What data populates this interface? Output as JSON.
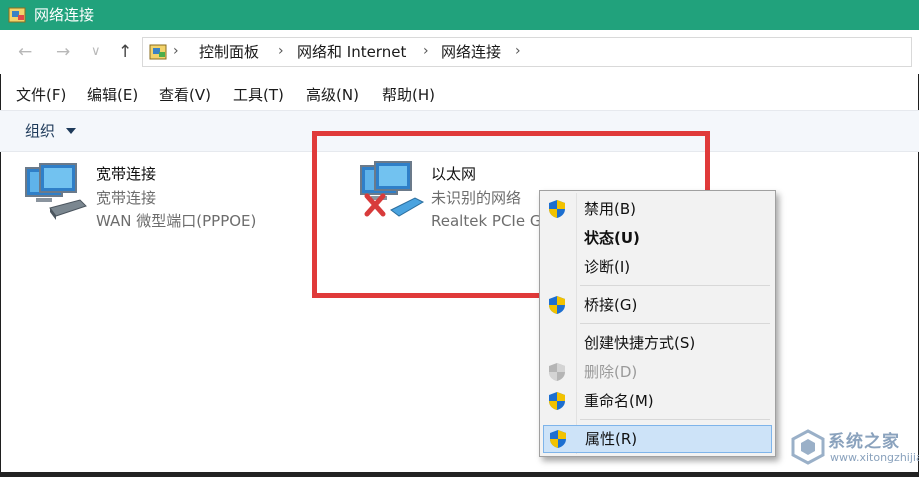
{
  "window": {
    "title": "网络连接"
  },
  "nav": {
    "back": "←",
    "forward": "→",
    "recent": "∨",
    "up": "↑"
  },
  "breadcrumb": {
    "items": [
      "控制面板",
      "网络和 Internet",
      "网络连接"
    ],
    "separator": "›"
  },
  "menubar": {
    "items": [
      "文件(F)",
      "编辑(E)",
      "查看(V)",
      "工具(T)",
      "高级(N)",
      "帮助(H)"
    ]
  },
  "toolbar": {
    "organize": "组织"
  },
  "connections": [
    {
      "name": "宽带连接",
      "status": "宽带连接",
      "device": "WAN 微型端口(PPPOE)",
      "icon": "broadband-connection-icon"
    },
    {
      "name": "以太网",
      "status": "未识别的网络",
      "device": "Realtek PCIe G",
      "icon": "ethernet-disconnected-icon"
    }
  ],
  "context_menu": {
    "items": [
      {
        "label": "禁用(B)",
        "shield": true,
        "bold": false,
        "disabled": false
      },
      {
        "label": "状态(U)",
        "shield": false,
        "bold": true,
        "disabled": false
      },
      {
        "label": "诊断(I)",
        "shield": false,
        "bold": false,
        "disabled": false
      },
      {
        "label": "桥接(G)",
        "shield": true,
        "bold": false,
        "disabled": false
      },
      {
        "label": "创建快捷方式(S)",
        "shield": false,
        "bold": false,
        "disabled": false
      },
      {
        "label": "删除(D)",
        "shield": true,
        "bold": false,
        "disabled": true
      },
      {
        "label": "重命名(M)",
        "shield": true,
        "bold": false,
        "disabled": false
      },
      {
        "label": "属性(R)",
        "shield": true,
        "bold": false,
        "disabled": false,
        "highlighted": true
      }
    ]
  },
  "watermark": {
    "text": "系统之家",
    "url": "www.xitongzhijia.net"
  },
  "colors": {
    "titlebar": "#21a27c",
    "highlight_box": "#e03a3a",
    "menu_hover": "#cde3f8"
  }
}
